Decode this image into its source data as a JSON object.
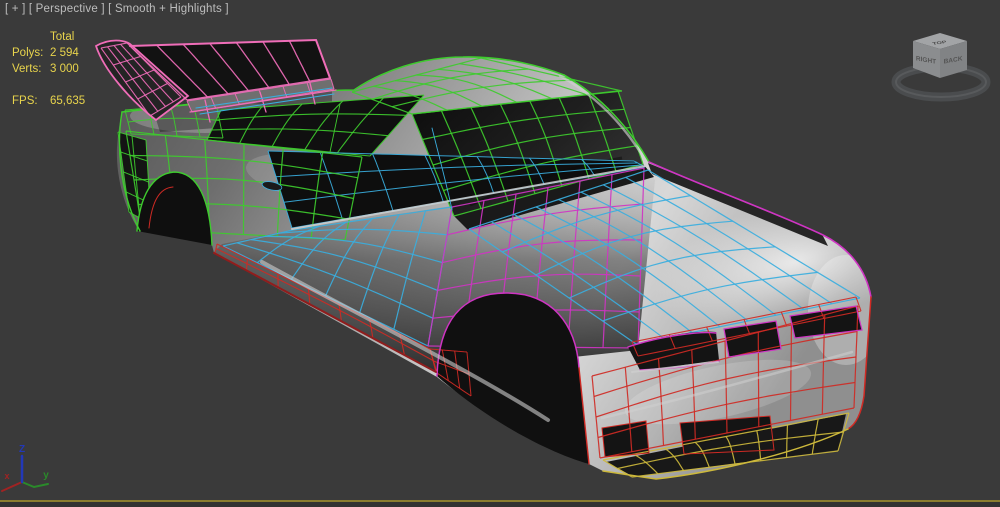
{
  "viewport": {
    "label": "[ + ] [ Perspective ] [ Smooth + Highlights ]"
  },
  "stats": {
    "total_header": "Total",
    "polys_label": "Polys:",
    "polys_value": "2 594",
    "verts_label": "Verts:",
    "verts_value": "3 000",
    "fps_label": "FPS:",
    "fps_value": "65,635"
  },
  "viewcube": {
    "top": "TOP",
    "left": "RIGHT",
    "right": "BACK"
  },
  "axis_gizmo": {
    "z": "Z",
    "y": "y",
    "x": "x"
  },
  "colors": {
    "background": "#3a3a3a",
    "outside_viewport": "#323232",
    "active_border": "#8b7d2f",
    "stats_text": "#e8d44c",
    "label_text": "#bdbdbd",
    "wire_green": "#3ecb2e",
    "wire_cyan": "#3aaede",
    "wire_magenta": "#cf34c3",
    "wire_pink": "#ef6db8",
    "wire_red": "#cf2a24",
    "wire_dark_red": "#8f1d1d",
    "wire_yellow": "#cdb93c",
    "glass": "#121212",
    "body_light": "#c9c9c9",
    "body_dark": "#4e4e4e"
  }
}
